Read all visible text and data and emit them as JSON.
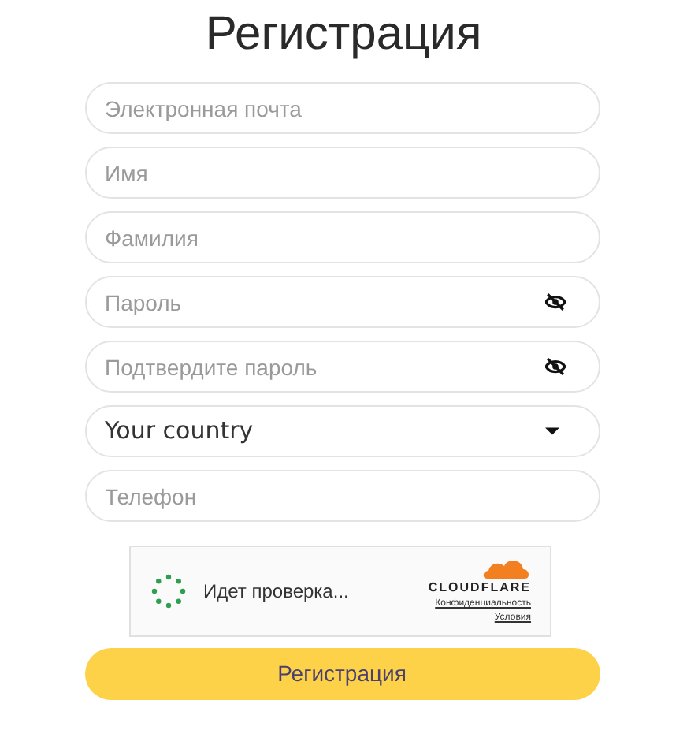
{
  "title": "Регистрация",
  "fields": [
    {
      "kind": "text",
      "placeholder": "Электронная почта"
    },
    {
      "kind": "text",
      "placeholder": "Имя"
    },
    {
      "kind": "text",
      "placeholder": "Фамилия"
    },
    {
      "kind": "password",
      "placeholder": "Пароль"
    },
    {
      "kind": "password",
      "placeholder": "Подтвердите пароль"
    },
    {
      "kind": "select",
      "value": "Your country"
    },
    {
      "kind": "text",
      "placeholder": "Телефон"
    }
  ],
  "captcha": {
    "status": "Идет проверка...",
    "brand": "CLOUDFLARE",
    "links": [
      "Конфиденциальность",
      "Условия"
    ]
  },
  "submit": "Регистрация"
}
